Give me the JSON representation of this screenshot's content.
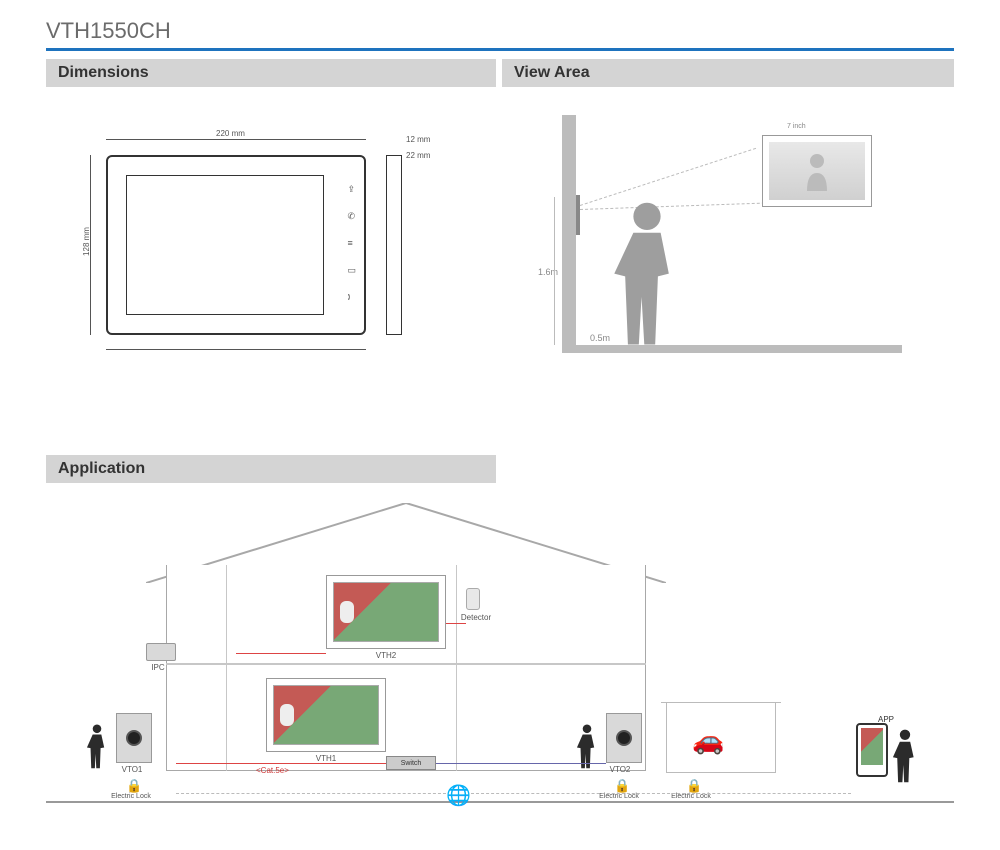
{
  "title": "VTH1550CH",
  "sections": {
    "dimensions": "Dimensions",
    "view_area": "View Area",
    "application": "Application"
  },
  "dimensions": {
    "width_mm": "220 mm",
    "height_mm": "128 mm",
    "side_depth_mm": "12 mm",
    "side_total_mm": "22 mm"
  },
  "view_area": {
    "mount_height": "1.6m",
    "distance": "0.5m",
    "screen_size": "7 inch"
  },
  "application": {
    "ipc": "IPC",
    "vto1": "VTO1",
    "vto2": "VTO2",
    "vth1": "VTH1",
    "vth2": "VTH2",
    "switch": "Switch",
    "cable": "<Cat.5e>",
    "detector": "Detector",
    "electric_lock": "Electric Lock",
    "app": "APP"
  }
}
